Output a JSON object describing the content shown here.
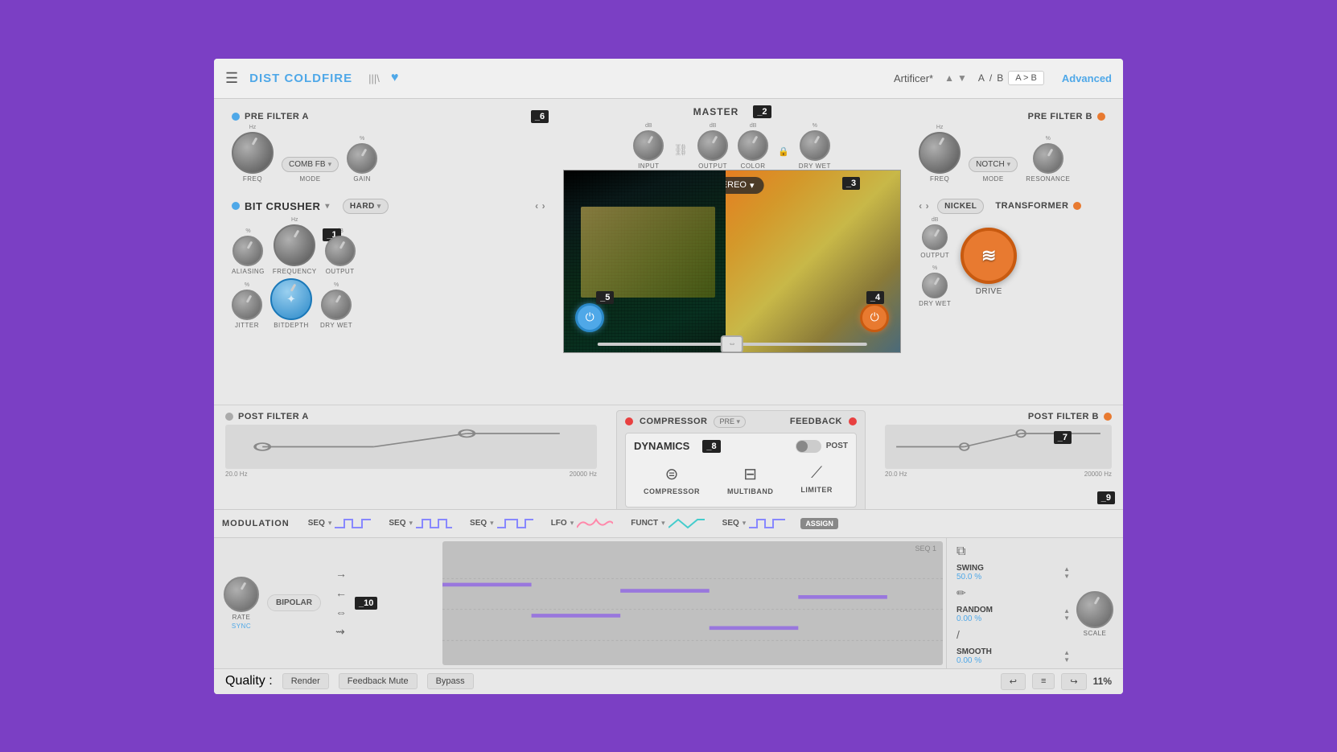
{
  "titlebar": {
    "hamburger": "☰",
    "app_title": "DIST COLDFIRE",
    "waveform_icon": "|||\\",
    "heart_icon": "♥",
    "preset_name": "Artificer*",
    "nav_up": "▲",
    "nav_down": "▼",
    "ab_a": "A",
    "ab_slash": "/",
    "ab_b": "B",
    "ab_copy": "A > B",
    "advanced": "Advanced"
  },
  "pre_filter_a": {
    "title": "PRE FILTER A",
    "freq_label": "FREQ",
    "freq_unit": "Hz",
    "mode_label": "MODE",
    "mode_value": "COMB FB",
    "gain_label": "GAIN",
    "gain_unit": "%"
  },
  "bit_crusher": {
    "title": "BIT CRUSHER",
    "mode": "HARD",
    "aliasing_label": "ALIASING",
    "aliasing_unit": "%",
    "frequency_label": "FREQUENCY",
    "frequency_unit": "Hz",
    "output_label": "OUTPUT",
    "output_unit": "dB",
    "jitter_label": "JITTER",
    "jitter_unit": "%",
    "bitdepth_label": "BITDEPTH",
    "drywet_label": "DRY WET",
    "drywet_unit": "%"
  },
  "master": {
    "title": "MASTER",
    "input_label": "INPUT",
    "input_unit": "dB",
    "output_label": "OUTPUT",
    "output_unit": "dB",
    "color_label": "COLOR",
    "dry_wet_label": "DRY WET",
    "dry_wet_unit": "%",
    "stereo_label": "STEREO"
  },
  "pre_filter_b": {
    "title": "PRE FILTER B",
    "freq_label": "FREQ",
    "freq_unit": "Hz",
    "mode_label": "MODE",
    "mode_value": "NOTCH",
    "resonance_label": "RESONANCE",
    "resonance_unit": "%"
  },
  "transformer": {
    "title": "TRANSFORMER",
    "mode_value": "NICKEL",
    "output_label": "OUTPUT",
    "output_unit": "dB",
    "drywet_label": "DRY WET",
    "drywet_unit": "%",
    "drive_label": "DRIVE",
    "icon": "≋"
  },
  "post_filter_a": {
    "title": "POST FILTER A",
    "hz_low": "20.0 Hz",
    "hz_high": "20000 Hz"
  },
  "post_filter_b": {
    "title": "POST FILTER B",
    "hz_low": "20.0 Hz",
    "hz_high": "20000 Hz"
  },
  "compressor": {
    "title": "COMPRESSOR",
    "pre_label": "PRE",
    "feedback_label": "FEEDBACK"
  },
  "dynamics": {
    "title": "DYNAMICS",
    "post_label": "POST",
    "compressor_label": "COMPRESSOR",
    "multiband_label": "MULTIBAND",
    "limiter_label": "LIMITER"
  },
  "modulation": {
    "title": "MODULATION",
    "slots": [
      {
        "type": "SEQ",
        "wave": "square"
      },
      {
        "type": "SEQ",
        "wave": "pulse"
      },
      {
        "type": "SEQ",
        "wave": "square2"
      },
      {
        "type": "LFO",
        "wave": "sine"
      },
      {
        "type": "FUNCT",
        "wave": "tri"
      },
      {
        "type": "SEQ",
        "wave": "square3"
      }
    ],
    "assign_label": "ASSIGN",
    "bipolar_label": "BIPOLAR",
    "rate_label": "RATE",
    "sync_label": "SYNC",
    "seq1_label": "SEQ 1",
    "scale_label": "SCALE",
    "swing_label": "SWING",
    "swing_value": "50.0 %",
    "random_label": "RANDOM",
    "random_value": "0.00 %",
    "smooth_label": "SMOOTH",
    "smooth_value": "0.00 %"
  },
  "statusbar": {
    "quality_label": "Quality :",
    "render_btn": "Render",
    "feedback_mute_btn": "Feedback Mute",
    "bypass_btn": "Bypass",
    "undo_icon": "↩",
    "menu_icon": "≡",
    "redo_icon": "↪",
    "zoom": "11%"
  },
  "badges": {
    "b1": "_1",
    "b2": "_2",
    "b3": "_3",
    "b4": "_4",
    "b5": "_5",
    "b6": "_6",
    "b7": "_7",
    "b8": "_8",
    "b9": "_9",
    "b10": "_10"
  },
  "colors": {
    "blue": "#4fa8e8",
    "orange": "#e87a30",
    "red": "#e84040",
    "accent_purple": "#7b3fc4"
  }
}
